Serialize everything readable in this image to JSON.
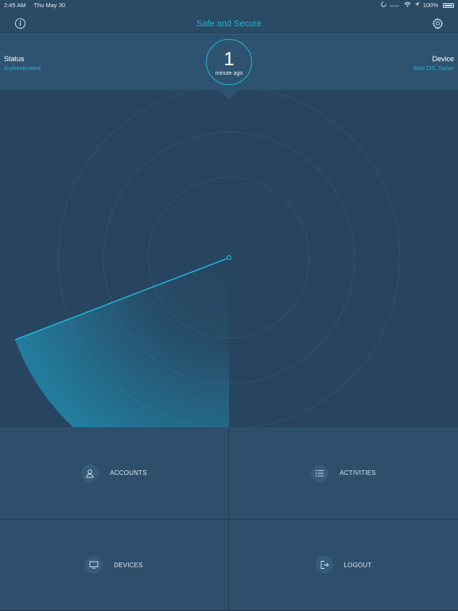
{
  "status_bar": {
    "time": "2:45 AM",
    "date": "Thu May 30",
    "battery": "100%"
  },
  "nav": {
    "title": "Safe and Secure",
    "info_icon": "info-icon",
    "settings_icon": "gear-icon"
  },
  "status": {
    "label": "Status",
    "value": "Authenticated"
  },
  "device": {
    "label": "Device",
    "value": "Mac OS, Safari"
  },
  "timer": {
    "number": "1",
    "unit": "minute ago"
  },
  "tiles": [
    {
      "label": "ACCOUNTS",
      "icon": "user-icon"
    },
    {
      "label": "ACTIVITIES",
      "icon": "list-icon"
    },
    {
      "label": "DEVICES",
      "icon": "monitor-icon"
    },
    {
      "label": "LOGOUT",
      "icon": "logout-icon"
    }
  ],
  "colors": {
    "accent": "#1fb3d8",
    "background": "#2a4b66",
    "radar_background": "#274560"
  }
}
